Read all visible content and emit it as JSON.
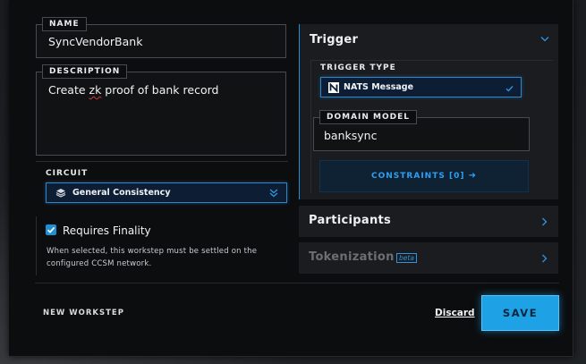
{
  "form": {
    "name": {
      "label": "NAME",
      "value": "SyncVendorBank"
    },
    "description": {
      "label": "DESCRIPTION",
      "value_prefix": "Create ",
      "value_misspelled": "zk",
      "value_suffix": " proof of bank record"
    },
    "circuit": {
      "label": "CIRCUIT",
      "selected": "General Consistency",
      "icon": "layers-icon"
    },
    "finality": {
      "checked": true,
      "label": "Requires Finality",
      "help": "When selected, this workstep must be settled on the configured CCSM network."
    }
  },
  "trigger": {
    "title": "Trigger",
    "expanded": true,
    "trigger_type": {
      "label": "TRIGGER TYPE",
      "selected": "NATS Message",
      "icon": "nats-logo-icon"
    },
    "domain_model": {
      "label": "DOMAIN MODEL",
      "value": "banksync"
    },
    "constraints_label": "CONSTRAINTS [0]"
  },
  "participants": {
    "title": "Participants"
  },
  "tokenization": {
    "title": "Tokenization",
    "badge": "beta"
  },
  "footer": {
    "title": "NEW WORKSTEP",
    "discard_label": "Discard",
    "save_label": "SAVE"
  },
  "colors": {
    "accent": "#1fa1e6",
    "link": "#2e9ff2",
    "modal_bg": "#0c0d0f",
    "panel_bg": "#1a1c1f"
  }
}
